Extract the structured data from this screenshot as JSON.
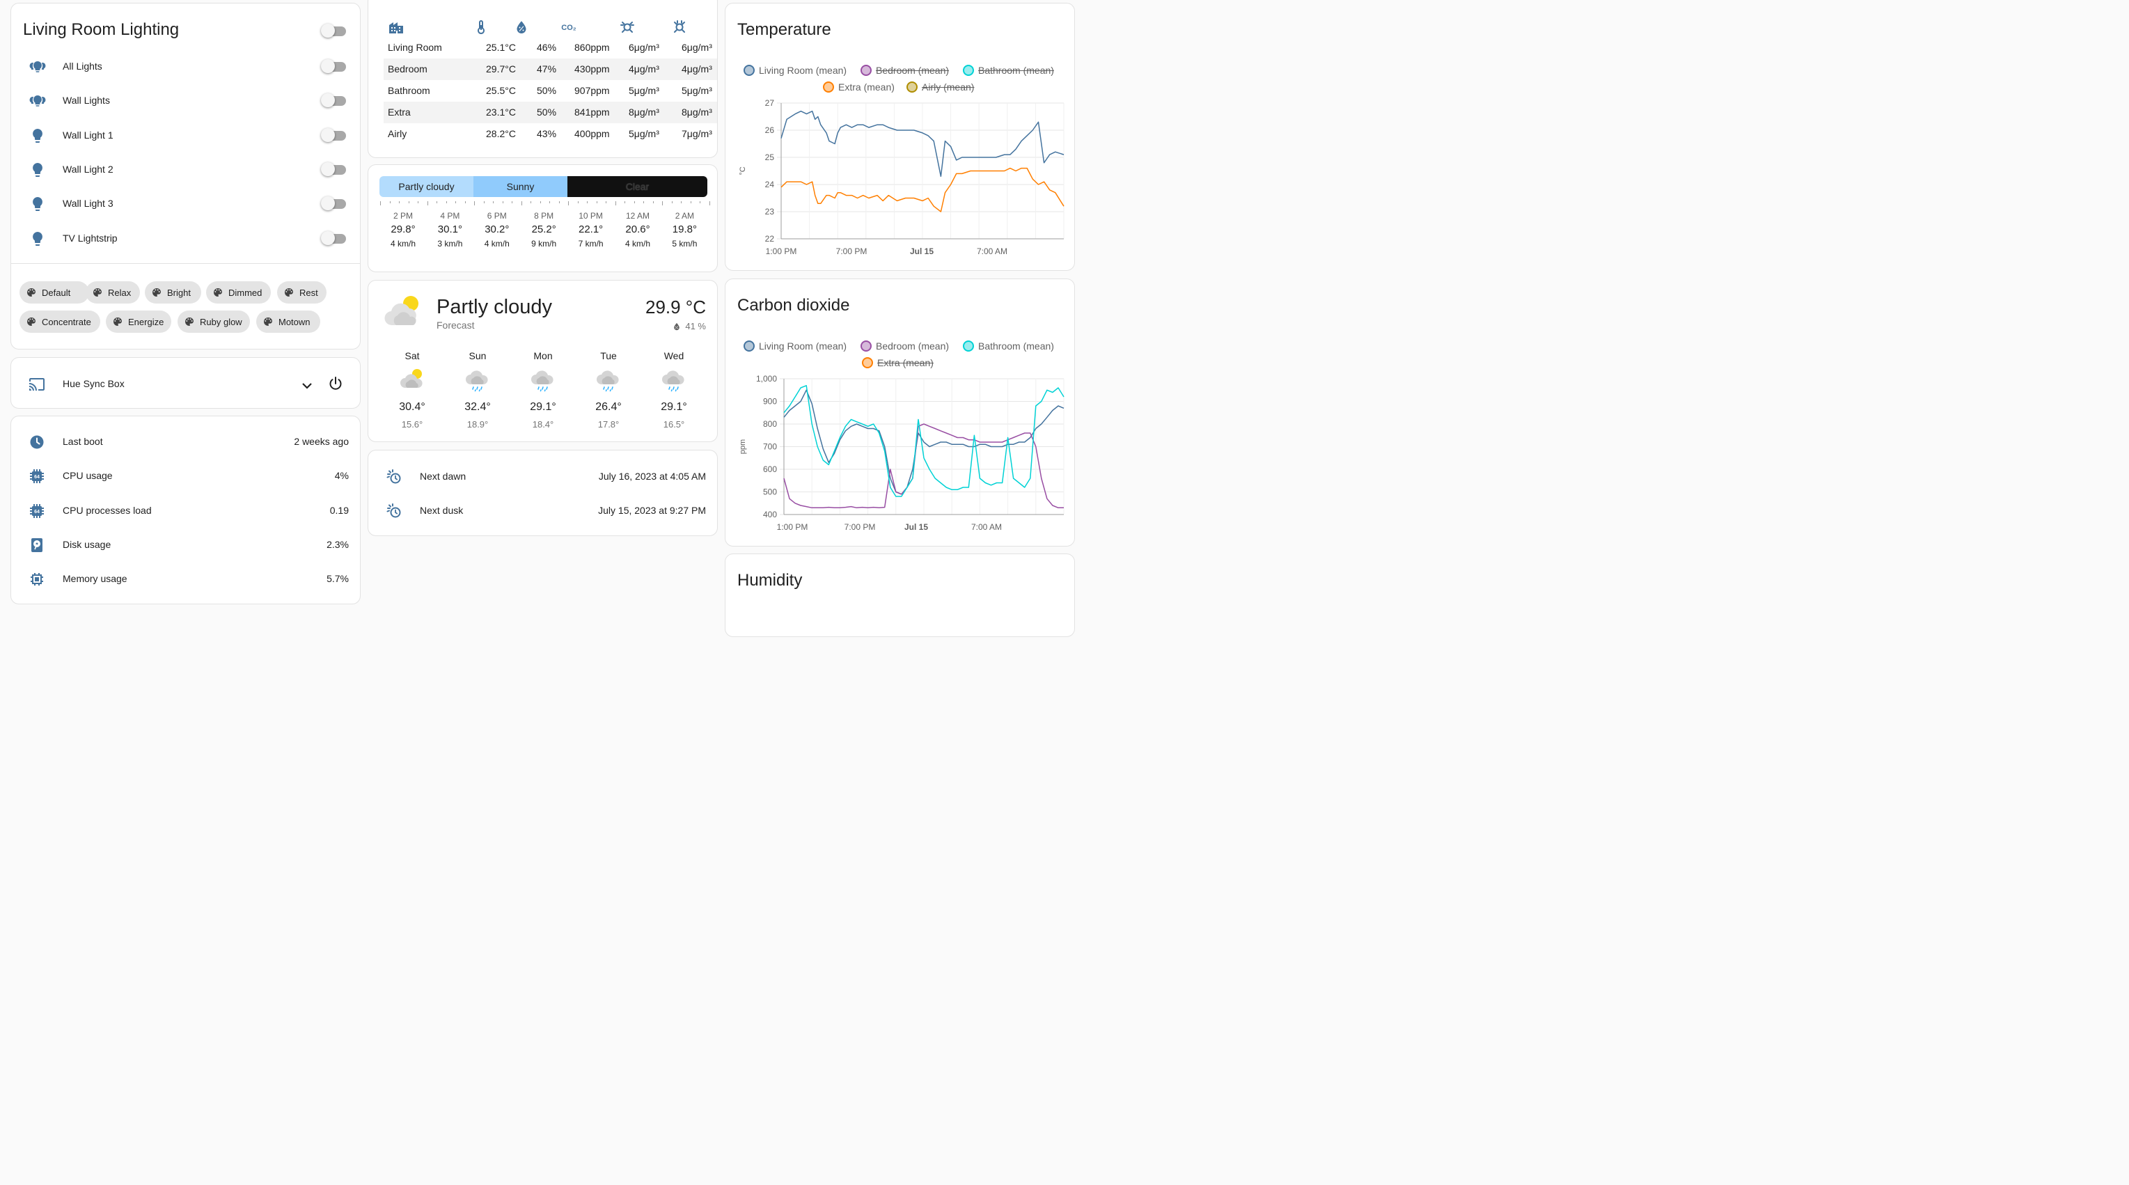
{
  "lighting": {
    "title": "Living Room Lighting",
    "rows": [
      {
        "label": "All Lights",
        "icon": "lightbulb-group-icon"
      },
      {
        "label": "Wall Lights",
        "icon": "lightbulb-group-icon"
      },
      {
        "label": "Wall Light 1",
        "icon": "lightbulb-icon"
      },
      {
        "label": "Wall Light 2",
        "icon": "lightbulb-icon"
      },
      {
        "label": "Wall Light 3",
        "icon": "lightbulb-icon"
      },
      {
        "label": "TV Lightstrip",
        "icon": "lightbulb-icon"
      }
    ],
    "scenes": [
      "Default",
      "Relax",
      "Bright",
      "Dimmed",
      "Rest",
      "Concentrate",
      "Energize",
      "Ruby glow",
      "Motown"
    ]
  },
  "sync_box": {
    "label": "Hue Sync Box"
  },
  "system": {
    "rows": [
      {
        "label": "Last boot",
        "value": "2 weeks ago",
        "icon": "clock-icon"
      },
      {
        "label": "CPU usage",
        "value": "4%",
        "icon": "cpu-64-icon"
      },
      {
        "label": "CPU processes load",
        "value": "0.19",
        "icon": "cpu-64-icon"
      },
      {
        "label": "Disk usage",
        "value": "2.3%",
        "icon": "harddisk-icon"
      },
      {
        "label": "Memory usage",
        "value": "5.7%",
        "icon": "memory-icon"
      }
    ]
  },
  "air_table": {
    "header_icons": [
      "home-city-icon",
      "thermometer-icon",
      "water-percent-icon",
      "molecule-co2-icon",
      "pm25-icon",
      "pm10-icon"
    ],
    "rows": [
      [
        "Living Room",
        "25.1°C",
        "46%",
        "860ppm",
        "6μg/m³",
        "6μg/m³"
      ],
      [
        "Bedroom",
        "29.7°C",
        "47%",
        "430ppm",
        "4μg/m³",
        "4μg/m³"
      ],
      [
        "Bathroom",
        "25.5°C",
        "50%",
        "907ppm",
        "5μg/m³",
        "5μg/m³"
      ],
      [
        "Extra",
        "23.1°C",
        "50%",
        "841ppm",
        "8μg/m³",
        "8μg/m³"
      ],
      [
        "Airly",
        "28.2°C",
        "43%",
        "400ppm",
        "5μg/m³",
        "7μg/m³"
      ]
    ]
  },
  "timeline": {
    "segments": [
      "Partly cloudy",
      "Sunny",
      "Clear"
    ],
    "hours": [
      {
        "time": "2 PM",
        "temp": "29.8°",
        "wind": "4 km/h"
      },
      {
        "time": "4 PM",
        "temp": "30.1°",
        "wind": "3 km/h"
      },
      {
        "time": "6 PM",
        "temp": "30.2°",
        "wind": "4 km/h"
      },
      {
        "time": "8 PM",
        "temp": "25.2°",
        "wind": "9 km/h"
      },
      {
        "time": "10 PM",
        "temp": "22.1°",
        "wind": "7 km/h"
      },
      {
        "time": "12 AM",
        "temp": "20.6°",
        "wind": "4 km/h"
      },
      {
        "time": "2 AM",
        "temp": "19.8°",
        "wind": "5 km/h"
      }
    ]
  },
  "forecast": {
    "condition": "Partly cloudy",
    "subtitle": "Forecast",
    "temperature": "29.9 °C",
    "humidity": "41 %",
    "days": [
      {
        "day": "Sat",
        "high": "30.4°",
        "low": "15.6°",
        "icon": "partly-cloudy-icon"
      },
      {
        "day": "Sun",
        "high": "32.4°",
        "low": "18.9°",
        "icon": "rainy-icon"
      },
      {
        "day": "Mon",
        "high": "29.1°",
        "low": "18.4°",
        "icon": "rainy-icon"
      },
      {
        "day": "Tue",
        "high": "26.4°",
        "low": "17.8°",
        "icon": "rainy-icon"
      },
      {
        "day": "Wed",
        "high": "29.1°",
        "low": "16.5°",
        "icon": "rainy-icon"
      }
    ]
  },
  "sun": {
    "rows": [
      {
        "label": "Next dawn",
        "value": "July 16, 2023 at 4:05 AM"
      },
      {
        "label": "Next dusk",
        "value": "July 15, 2023 at 9:27 PM"
      }
    ]
  },
  "colors": {
    "accent": "#44739e",
    "living": "#44739e",
    "bedroom": "#984ea3",
    "bathroom": "#00d2d5",
    "extra": "#ff7f00",
    "airly": "#af8d00"
  },
  "chart_data": [
    {
      "type": "line",
      "title": "Temperature",
      "ylabel": "°C",
      "ylim": [
        22,
        27
      ],
      "yticks": [
        "27",
        "26",
        "25",
        "24",
        "23",
        "22"
      ],
      "xticks": [
        "1:00 PM",
        "7:00 PM",
        "Jul 15",
        "7:00 AM"
      ],
      "grid": true,
      "legend": [
        {
          "name": "Living Room (mean)",
          "hidden": false,
          "color": "#44739e"
        },
        {
          "name": "Bedroom (mean)",
          "hidden": true,
          "color": "#984ea3"
        },
        {
          "name": "Bathroom (mean)",
          "hidden": true,
          "color": "#00d2d5"
        },
        {
          "name": "Extra (mean)",
          "hidden": false,
          "color": "#ff7f00"
        },
        {
          "name": "Airly (mean)",
          "hidden": true,
          "color": "#af8d00"
        }
      ],
      "series": [
        {
          "name": "Living Room (mean)",
          "color": "#44739e",
          "values": [
            25.7,
            26.4,
            26.6,
            26.7,
            26.6,
            26.7,
            26.4,
            26.5,
            26.2,
            25.9,
            25.6,
            25.5,
            25.9,
            26.1,
            26.2,
            26.1,
            26.2,
            26.2,
            26.1,
            26.2,
            26.2,
            26.1,
            26.0,
            26.0,
            26.0,
            25.9,
            25.8,
            25.6,
            24.3,
            25.6,
            25.4,
            24.9,
            25.0,
            25.0,
            25.0,
            25.0,
            25.0,
            25.1,
            25.1,
            25.3,
            25.6,
            25.8,
            26.0,
            26.3,
            24.8,
            25.1,
            25.2,
            25.1
          ]
        }
      ],
      "x_frac": [
        0.0,
        0.02,
        0.05,
        0.07,
        0.09,
        0.11,
        0.12,
        0.13,
        0.14,
        0.16,
        0.17,
        0.19,
        0.2,
        0.21,
        0.23,
        0.25,
        0.27,
        0.29,
        0.31,
        0.34,
        0.36,
        0.38,
        0.41,
        0.44,
        0.47,
        0.5,
        0.52,
        0.54,
        0.565,
        0.58,
        0.6,
        0.62,
        0.64,
        0.67,
        0.7,
        0.73,
        0.76,
        0.79,
        0.81,
        0.83,
        0.85,
        0.87,
        0.89,
        0.91,
        0.93,
        0.95,
        0.97,
        1.0
      ],
      "series2": {
        "name": "Extra (mean)",
        "color": "#ff7f00",
        "values": [
          23.9,
          24.1,
          24.1,
          24.1,
          24.0,
          24.1,
          23.6,
          23.3,
          23.3,
          23.6,
          23.6,
          23.5,
          23.7,
          23.7,
          23.6,
          23.6,
          23.5,
          23.6,
          23.5,
          23.6,
          23.4,
          23.6,
          23.4,
          23.5,
          23.5,
          23.4,
          23.5,
          23.2,
          23.0,
          23.7,
          24.0,
          24.4,
          24.4,
          24.5,
          24.5,
          24.5,
          24.5,
          24.5,
          24.6,
          24.5,
          24.6,
          24.6,
          24.2,
          24.0,
          24.1,
          23.8,
          23.7,
          23.2
        ],
        "x_frac": [
          0.0,
          0.02,
          0.05,
          0.07,
          0.09,
          0.11,
          0.12,
          0.13,
          0.14,
          0.16,
          0.17,
          0.19,
          0.2,
          0.21,
          0.23,
          0.25,
          0.27,
          0.29,
          0.31,
          0.34,
          0.36,
          0.38,
          0.41,
          0.44,
          0.47,
          0.5,
          0.52,
          0.54,
          0.565,
          0.58,
          0.6,
          0.62,
          0.64,
          0.67,
          0.7,
          0.73,
          0.76,
          0.79,
          0.81,
          0.83,
          0.85,
          0.87,
          0.89,
          0.91,
          0.93,
          0.95,
          0.97,
          1.0
        ]
      }
    },
    {
      "type": "line",
      "title": "Carbon dioxide",
      "ylabel": "ppm",
      "ylim": [
        400,
        1000
      ],
      "yticks": [
        "1,000",
        "900",
        "800",
        "700",
        "600",
        "500",
        "400"
      ],
      "xticks": [
        "1:00 PM",
        "7:00 PM",
        "Jul 15",
        "7:00 AM"
      ],
      "grid": true,
      "legend": [
        {
          "name": "Living Room (mean)",
          "hidden": false,
          "color": "#44739e"
        },
        {
          "name": "Bedroom (mean)",
          "hidden": false,
          "color": "#984ea3"
        },
        {
          "name": "Bathroom (mean)",
          "hidden": false,
          "color": "#00d2d5"
        },
        {
          "name": "Extra (mean)",
          "hidden": true,
          "color": "#ff7f00"
        }
      ],
      "x_frac": [
        0.0,
        0.02,
        0.04,
        0.06,
        0.08,
        0.1,
        0.12,
        0.14,
        0.16,
        0.18,
        0.2,
        0.22,
        0.24,
        0.26,
        0.28,
        0.3,
        0.32,
        0.34,
        0.36,
        0.38,
        0.4,
        0.42,
        0.44,
        0.46,
        0.48,
        0.5,
        0.52,
        0.54,
        0.56,
        0.58,
        0.6,
        0.62,
        0.64,
        0.66,
        0.68,
        0.7,
        0.72,
        0.74,
        0.76,
        0.78,
        0.8,
        0.82,
        0.84,
        0.86,
        0.88,
        0.9,
        0.92,
        0.94,
        0.96,
        0.98,
        1.0
      ],
      "series": [
        {
          "name": "Living Room (mean)",
          "color": "#44739e",
          "values": [
            830,
            860,
            880,
            900,
            950,
            890,
            780,
            690,
            630,
            670,
            730,
            770,
            790,
            800,
            790,
            780,
            780,
            770,
            700,
            560,
            500,
            490,
            520,
            600,
            760,
            720,
            700,
            710,
            720,
            720,
            710,
            710,
            710,
            700,
            700,
            710,
            710,
            700,
            700,
            700,
            710,
            710,
            720,
            720,
            740,
            780,
            800,
            830,
            860,
            880,
            870
          ]
        },
        {
          "name": "Bedroom (mean)",
          "color": "#984ea3",
          "values": [
            560,
            470,
            450,
            440,
            435,
            430,
            430,
            430,
            432,
            430,
            430,
            432,
            435,
            430,
            432,
            430,
            432,
            430,
            432,
            600,
            500,
            490,
            520,
            560,
            790,
            800,
            790,
            780,
            770,
            760,
            750,
            740,
            740,
            730,
            730,
            720,
            720,
            720,
            720,
            720,
            730,
            740,
            750,
            760,
            760,
            700,
            560,
            470,
            440,
            430,
            430
          ]
        },
        {
          "name": "Bathroom (mean)",
          "color": "#00d2d5",
          "values": [
            850,
            880,
            920,
            960,
            970,
            800,
            700,
            640,
            620,
            680,
            740,
            790,
            820,
            810,
            800,
            790,
            800,
            760,
            680,
            520,
            480,
            480,
            520,
            560,
            820,
            650,
            600,
            560,
            540,
            520,
            510,
            510,
            520,
            520,
            750,
            560,
            540,
            530,
            540,
            540,
            740,
            560,
            540,
            520,
            560,
            880,
            900,
            950,
            940,
            960,
            920
          ]
        }
      ]
    },
    {
      "type": "line",
      "title": "Humidity"
    }
  ]
}
